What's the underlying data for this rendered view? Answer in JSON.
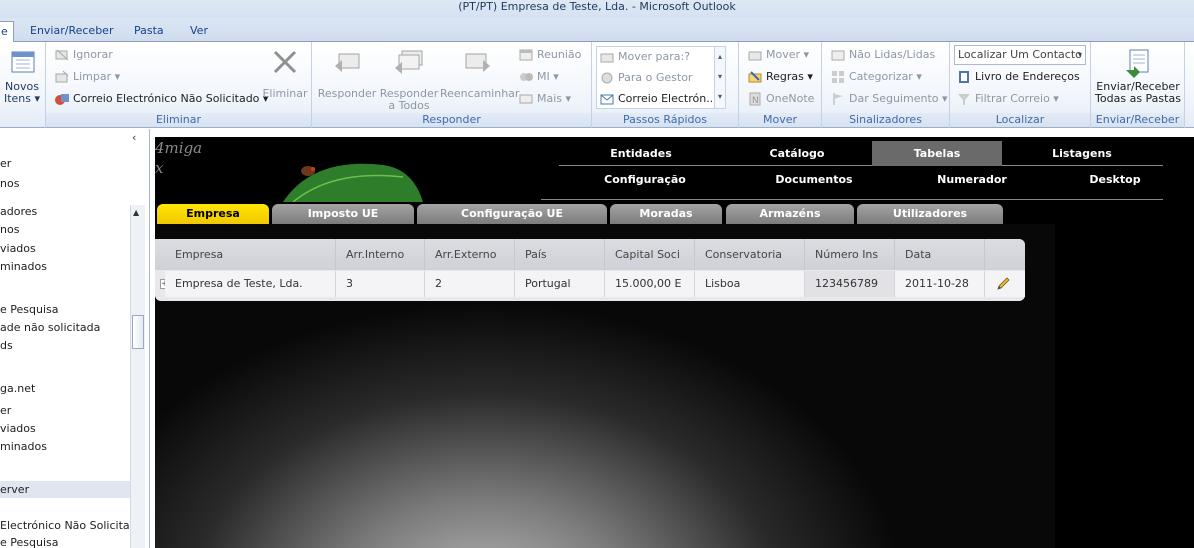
{
  "window": {
    "title": "(PT/PT) Empresa de Teste, Lda.  -  Microsoft Outlook"
  },
  "ribbon_tabs": [
    "e",
    "Enviar/Receber",
    "Pasta",
    "Ver"
  ],
  "ribbon": {
    "new": {
      "label_1": "Novos",
      "label_2": "Itens ▾"
    },
    "delete_group": {
      "label": "Eliminar",
      "ignore": "Ignorar",
      "clean": "Limpar ▾",
      "junk": "Correio Electrónico Não Solicitado ▾",
      "delete": "Eliminar"
    },
    "respond_group": {
      "label": "Responder",
      "reply": "Responder",
      "reply_all_1": "Responder",
      "reply_all_2": "a Todos",
      "forward": "Reencaminhar",
      "meeting": "Reunião",
      "im": "MI ▾",
      "more": "Mais ▾"
    },
    "quick_steps": {
      "label": "Passos Rápidos",
      "items": [
        "Mover para:?",
        "Para o Gestor",
        "Correio Electrón..."
      ]
    },
    "move_group": {
      "label": "Mover",
      "move": "Mover ▾",
      "rules": "Regras ▾",
      "onenote": "OneNote"
    },
    "tags_group": {
      "label": "Sinalizadores",
      "unread": "Não Lidas/Lidas",
      "categorize": "Categorizar ▾",
      "follow_up": "Dar Seguimento ▾"
    },
    "find_group": {
      "label": "Localizar",
      "find_contact": "Localizar Um Contacto",
      "address_book": "Livro de Endereços",
      "filter": "Filtrar Correio ▾"
    },
    "sendrecv_group": {
      "label": "Enviar/Receber",
      "btn_1": "Enviar/Receber",
      "btn_2": "Todas as Pastas"
    }
  },
  "nav": {
    "items": [
      "er",
      "nos",
      "adores",
      "nos",
      "viados",
      "minados",
      "e Pesquisa",
      "ade não solicitada",
      "ds",
      "ga.net",
      "er",
      "viados",
      "minados",
      "erver",
      "Electrónico Não Solicitado",
      "e Pesquisa"
    ]
  },
  "app": {
    "brand_1": "4miga",
    "brand_2": "x",
    "menu_row1": [
      "Entidades",
      "Catálogo",
      "Tabelas",
      "Listagens"
    ],
    "menu_row2": [
      "Configuração",
      "Documentos",
      "Numerador",
      "Desktop"
    ],
    "active_menu": "Tabelas",
    "subtabs": [
      "Empresa",
      "Imposto UE",
      "Configuração UE",
      "Moradas",
      "Armazéns",
      "Utilizadores"
    ],
    "active_subtab": "Empresa",
    "grid": {
      "headers": [
        "Empresa",
        "Arr.Interno",
        "Arr.Externo",
        "País",
        "Capital Soci",
        "Conservatoria",
        "Número Ins",
        "Data"
      ],
      "rows": [
        [
          "Empresa de Teste, Lda.",
          "3",
          "2",
          "Portugal",
          "15.000,00 E",
          "Lisboa",
          "123456789",
          "2011-10-28"
        ]
      ],
      "expander": "+"
    }
  },
  "colors": {
    "accent": "#ffe600",
    "tab_gray": "#8a8a8a",
    "menu_active": "#6a6a6a"
  }
}
